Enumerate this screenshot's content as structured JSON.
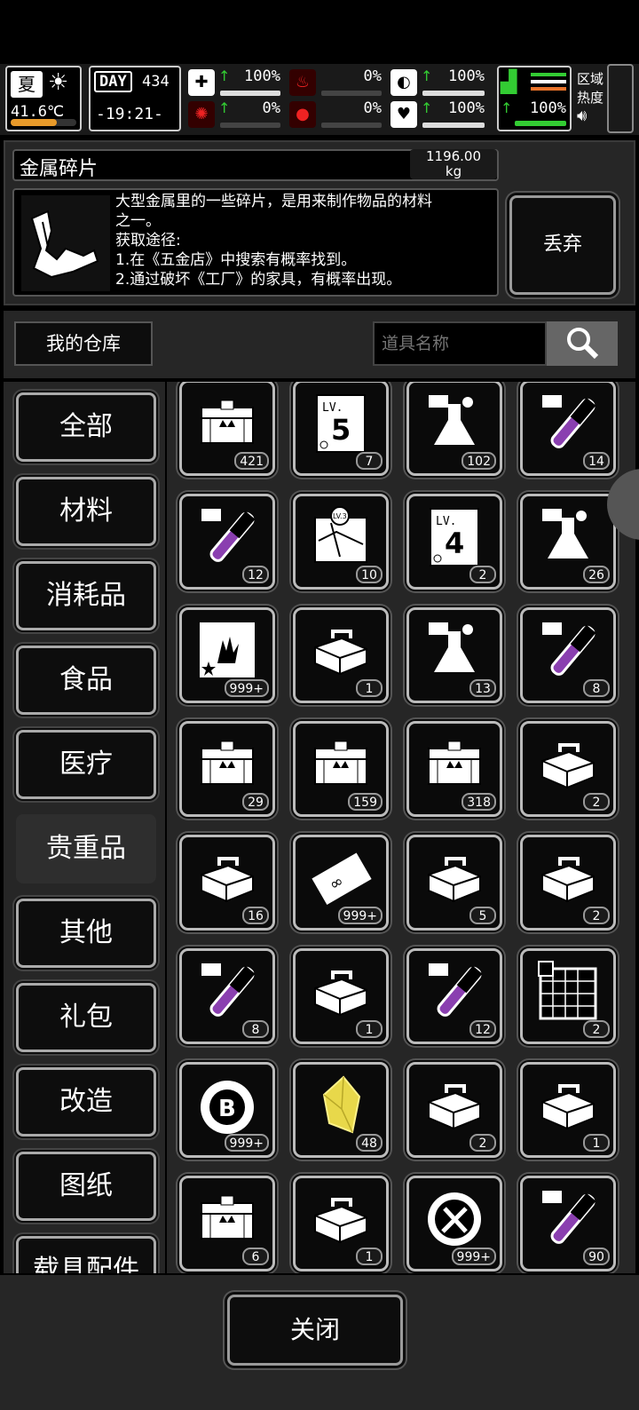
{
  "hud": {
    "season": "夏",
    "temperature": "41.6℃",
    "day_label": "DAY",
    "day_value": "434",
    "clock": "-19:21-",
    "stats": [
      {
        "icon": "medkit-icon",
        "pct": "100%",
        "fill": 1.0,
        "up": true
      },
      {
        "icon": "stomach-icon",
        "pct": "0%",
        "fill": 0.0,
        "up": false
      },
      {
        "icon": "pill-icon",
        "pct": "100%",
        "fill": 1.0,
        "up": true
      },
      {
        "icon": "brain-icon",
        "pct": "0%",
        "fill": 0.0,
        "up": true
      },
      {
        "icon": "blood-drop-icon",
        "pct": "0%",
        "fill": 0.0,
        "up": false
      },
      {
        "icon": "heart-icon",
        "pct": "100%",
        "fill": 1.0,
        "up": true
      }
    ],
    "stamina_pct": "100%",
    "region_line1": "区域",
    "region_line2": "热度"
  },
  "item": {
    "name": "金属碎片",
    "weight_line1": "1196.00",
    "weight_line2": "kg",
    "desc": [
      "大型金属里的一些碎片，是用来制作物品的材料",
      "之一。",
      "获取途径:",
      "1.在《五金店》中搜索有概率找到。",
      "2.通过破坏《工厂》的家具，有概率出现。"
    ],
    "discard_label": "丢弃"
  },
  "warehouse": {
    "title": "我的仓库",
    "search_placeholder": "道具名称"
  },
  "categories": [
    "全部",
    "材料",
    "消耗品",
    "食品",
    "医疗",
    "贵重品",
    "其他",
    "礼包",
    "改造",
    "图纸",
    "载具配件"
  ],
  "selected_category": 5,
  "items": [
    {
      "icon": "crate-icon",
      "count": "421"
    },
    {
      "icon": "level5-card-icon",
      "count": "7"
    },
    {
      "icon": "flask-icon",
      "count": "102"
    },
    {
      "icon": "test-tube-icon",
      "count": "14"
    },
    {
      "icon": "test-tube-icon",
      "count": "12"
    },
    {
      "icon": "map-icon",
      "count": "10"
    },
    {
      "icon": "level4-card-icon",
      "count": "2"
    },
    {
      "icon": "flask-icon",
      "count": "26"
    },
    {
      "icon": "zombie-poster-icon",
      "count": "999+"
    },
    {
      "icon": "toolbox-icon",
      "count": "1"
    },
    {
      "icon": "flask-icon",
      "count": "13"
    },
    {
      "icon": "test-tube-icon",
      "count": "8"
    },
    {
      "icon": "crate-icon",
      "count": "29"
    },
    {
      "icon": "crate-icon",
      "count": "159"
    },
    {
      "icon": "crate-icon",
      "count": "318"
    },
    {
      "icon": "toolbox-icon",
      "count": "2"
    },
    {
      "icon": "toolbox-icon",
      "count": "16"
    },
    {
      "icon": "ticket-icon",
      "count": "999+"
    },
    {
      "icon": "toolbox-icon",
      "count": "5"
    },
    {
      "icon": "toolbox-icon",
      "count": "2"
    },
    {
      "icon": "test-tube-icon",
      "count": "8"
    },
    {
      "icon": "toolbox-icon",
      "count": "1"
    },
    {
      "icon": "test-tube-icon",
      "count": "12"
    },
    {
      "icon": "blueprint-icon",
      "count": "2"
    },
    {
      "icon": "coin-icon",
      "count": "999+"
    },
    {
      "icon": "crystal-icon",
      "count": "48"
    },
    {
      "icon": "toolbox-icon",
      "count": "2"
    },
    {
      "icon": "toolbox-icon",
      "count": "1"
    },
    {
      "icon": "crate-icon",
      "count": "6"
    },
    {
      "icon": "toolbox-icon",
      "count": "1"
    },
    {
      "icon": "tools-badge-icon",
      "count": "999+"
    },
    {
      "icon": "test-tube-icon",
      "count": "90"
    }
  ],
  "close_label": "关闭",
  "colors": {
    "accent_green": "#33cc33",
    "alert_red": "#dd2222",
    "potion_purple": "#8a3fb0",
    "crystal_yellow": "#e8d84a"
  }
}
